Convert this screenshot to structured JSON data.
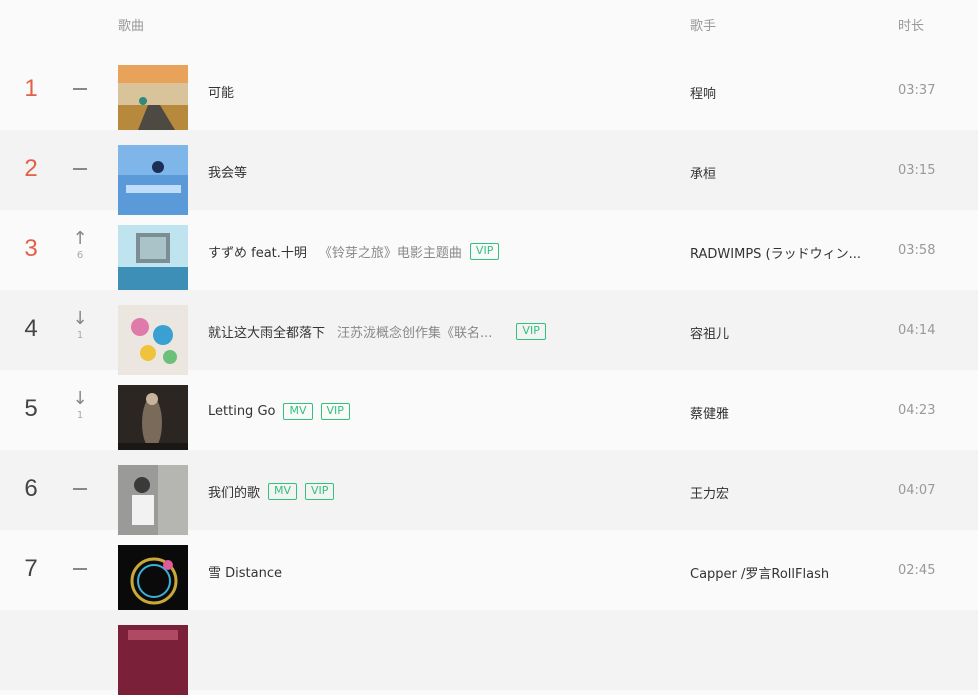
{
  "header": {
    "song": "歌曲",
    "singer": "歌手",
    "duration": "时长"
  },
  "colors": {
    "top_rank": "#e35f48",
    "tag": "#31c27c"
  },
  "rows": [
    {
      "rank": "1",
      "trend": "same",
      "trend_num": "",
      "title": "可能",
      "subtitle": "",
      "tags": [],
      "singer": "程响",
      "duration": "03:37",
      "cover": "road-sunset"
    },
    {
      "rank": "2",
      "trend": "same",
      "trend_num": "",
      "title": "我会等",
      "subtitle": "",
      "tags": [],
      "singer": "承桓",
      "duration": "03:15",
      "cover": "blue-sky"
    },
    {
      "rank": "3",
      "trend": "up",
      "trend_num": "6",
      "title": "すずめ feat.十明",
      "subtitle": "《铃芽之旅》电影主题曲",
      "tags": [
        "VIP"
      ],
      "singer": "RADWIMPS (ラッドウィン...",
      "duration": "03:58",
      "cover": "anime-sky"
    },
    {
      "rank": "4",
      "trend": "down",
      "trend_num": "1",
      "title": "就让这大雨全都落下",
      "subtitle": "汪苏泷概念创作集《联名...",
      "tags": [
        "VIP"
      ],
      "singer": "容祖儿",
      "duration": "04:14",
      "cover": "colorful-art"
    },
    {
      "rank": "5",
      "trend": "down",
      "trend_num": "1",
      "title": "Letting Go",
      "subtitle": "",
      "tags": [
        "MV",
        "VIP"
      ],
      "singer": "蔡健雅",
      "duration": "04:23",
      "cover": "dark-portrait"
    },
    {
      "rank": "6",
      "trend": "same",
      "trend_num": "",
      "title": "我们的歌",
      "subtitle": "",
      "tags": [
        "MV",
        "VIP"
      ],
      "singer": "王力宏",
      "duration": "04:07",
      "cover": "gray-portrait"
    },
    {
      "rank": "7",
      "trend": "same",
      "trend_num": "",
      "title": "雪 Distance",
      "subtitle": "",
      "tags": [],
      "singer": "Capper /罗言RollFlash",
      "duration": "02:45",
      "cover": "neon-circle"
    }
  ]
}
